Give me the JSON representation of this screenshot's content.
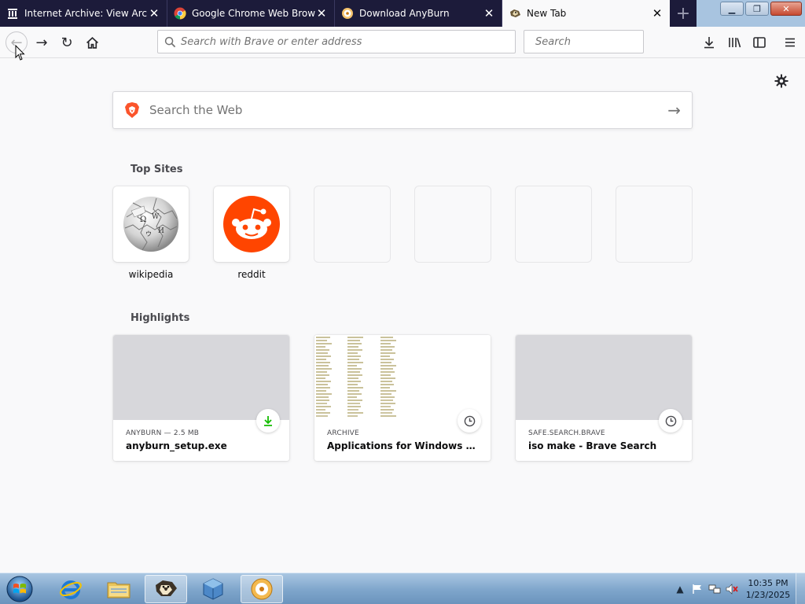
{
  "tabs": [
    {
      "title": "Internet Archive: View Archive",
      "icon": "archive-building-icon"
    },
    {
      "title": "Google Chrome Web Browser",
      "icon": "chrome-icon"
    },
    {
      "title": "Download AnyBurn",
      "icon": "anyburn-disc-icon"
    },
    {
      "title": "New Tab",
      "icon": "brave-lion-icon",
      "active": true
    }
  ],
  "toolbar": {
    "url_placeholder": "Search with Brave or enter address",
    "search_placeholder": "Search"
  },
  "newtab": {
    "search_placeholder": "Search the Web",
    "top_sites_title": "Top Sites",
    "top_sites": [
      {
        "label": "wikipedia",
        "icon": "wikipedia-globe-icon"
      },
      {
        "label": "reddit",
        "icon": "reddit-alien-icon"
      },
      {
        "label": ""
      },
      {
        "label": ""
      },
      {
        "label": ""
      },
      {
        "label": ""
      }
    ],
    "highlights_title": "Highlights",
    "highlights": [
      {
        "source": "ANYBURN — 2.5 MB",
        "title": "anyburn_setup.exe",
        "badge": "download-icon"
      },
      {
        "source": "ARCHIVE",
        "title": "Applications for Windows XP (ba...",
        "badge": "clock-icon"
      },
      {
        "source": "SAFE.SEARCH.BRAVE",
        "title": "iso make - Brave Search",
        "badge": "clock-icon"
      }
    ]
  },
  "taskbar": {
    "time": "10:35 PM",
    "date": "1/23/2025"
  },
  "colors": {
    "tabstrip": "#1c1b3a",
    "accent_download": "#12bc00",
    "reddit": "#ff4500"
  }
}
